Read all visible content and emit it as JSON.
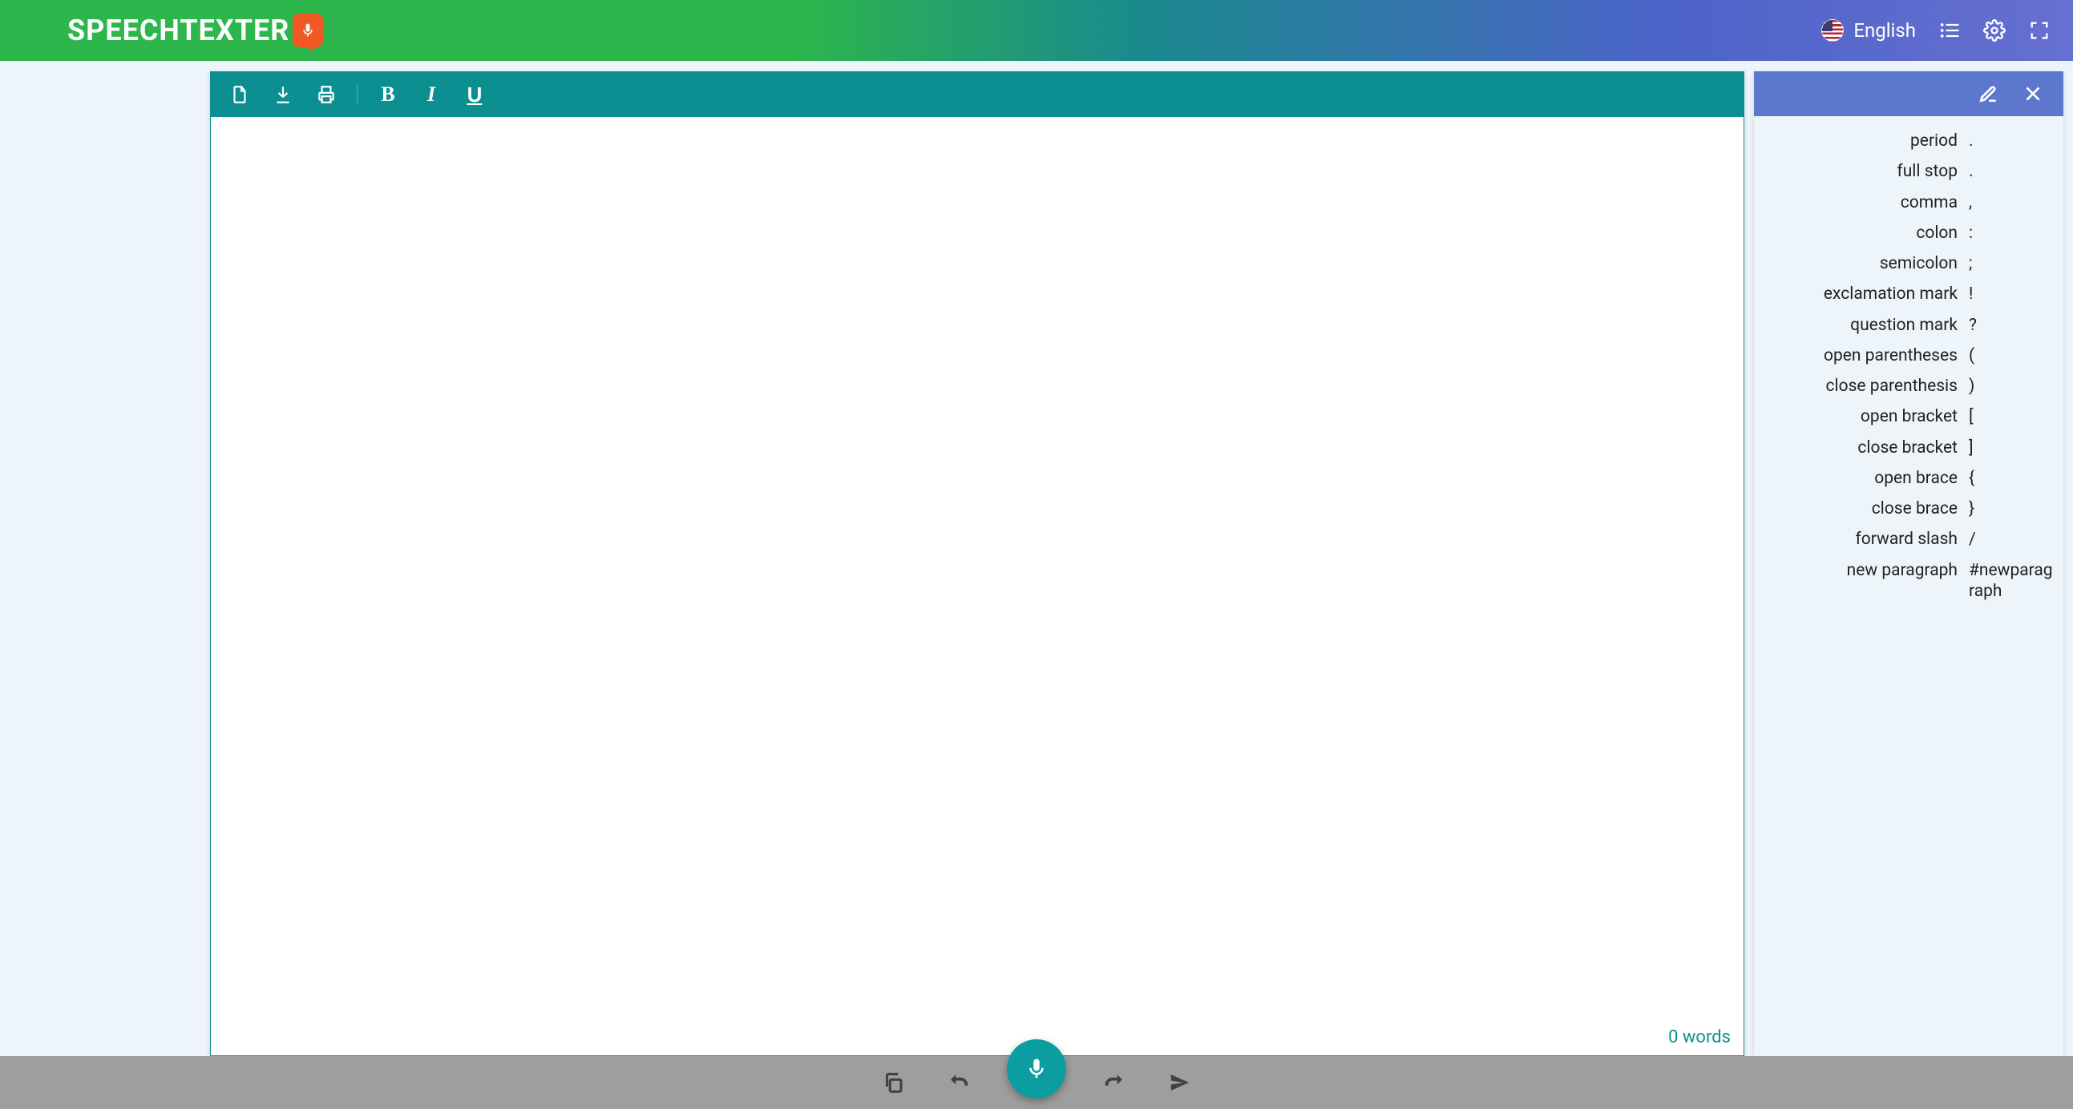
{
  "header": {
    "logo_text": "SPEECHTEXTER",
    "language_label": "English"
  },
  "editor": {
    "word_count_text": "0 words"
  },
  "sidebar": {
    "commands": [
      {
        "name": "period",
        "symbol": "."
      },
      {
        "name": "full stop",
        "symbol": "."
      },
      {
        "name": "comma",
        "symbol": ","
      },
      {
        "name": "colon",
        "symbol": ":"
      },
      {
        "name": "semicolon",
        "symbol": ";"
      },
      {
        "name": "exclamation mark",
        "symbol": "!"
      },
      {
        "name": "question mark",
        "symbol": "?"
      },
      {
        "name": "open parentheses",
        "symbol": "("
      },
      {
        "name": "close parenthesis",
        "symbol": ")"
      },
      {
        "name": "open bracket",
        "symbol": "["
      },
      {
        "name": "close bracket",
        "symbol": "]"
      },
      {
        "name": "open brace",
        "symbol": "{"
      },
      {
        "name": "close brace",
        "symbol": "}"
      },
      {
        "name": "forward slash",
        "symbol": "/"
      },
      {
        "name": "new paragraph",
        "symbol": "#newparagraph"
      }
    ]
  }
}
